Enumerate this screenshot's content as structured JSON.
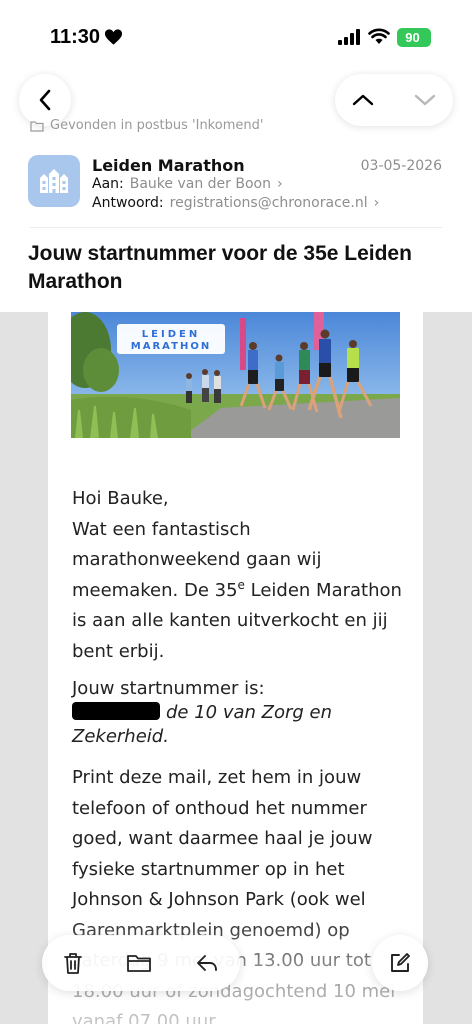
{
  "status": {
    "time": "11:30",
    "battery": "90"
  },
  "nav": {
    "back_icon": "chevron-left-icon",
    "prev_icon": "chevron-up-icon",
    "next_icon": "chevron-down-icon"
  },
  "mail": {
    "folder_note": "Gevonden in postbus 'Inkomend'",
    "sender": "Leiden Marathon",
    "date": "03-05-2026",
    "to_label": "Aan:",
    "to_value": "Bauke van der Boon",
    "reply_label": "Antwoord:",
    "reply_value": "registrations@chronorace.nl",
    "subject": "Jouw startnummer voor de 35e Leiden Marathon"
  },
  "body": {
    "banner_logo_line1": "LEIDEN",
    "banner_logo_line2": "MARATHON",
    "greeting": "Hoi Bauke,",
    "para1_a": "Wat een fantastisch marathonweekend gaan wij meemaken. De 35",
    "para1_sup": "e",
    "para1_b": " Leiden Marathon is aan alle kanten uitverkocht en jij bent erbij.",
    "startnr_label": "Jouw startnummer is:",
    "startnr_suffix": "de 10 van Zorg en Zekerheid.",
    "para3": "Print deze mail, zet hem in jouw telefoon of onthoud het nummer goed, want daarmee haal je jouw fysieke startnummer op in het Johnson & Johnson Park (ook wel Garenmarktplein genoemd) op zaterdag 9 mei van 13.00 uur tot 18.00 uur of zondagochtend 10 mei vanaf 07.00 uur."
  },
  "toolbar": {
    "trash_icon": "trash-icon",
    "folder_icon": "folder-icon",
    "reply_icon": "reply-icon",
    "compose_icon": "compose-icon"
  },
  "colors": {
    "battery": "#34c759",
    "avatar_bg": "#a9c6ec",
    "muted": "#8e8e8e"
  }
}
